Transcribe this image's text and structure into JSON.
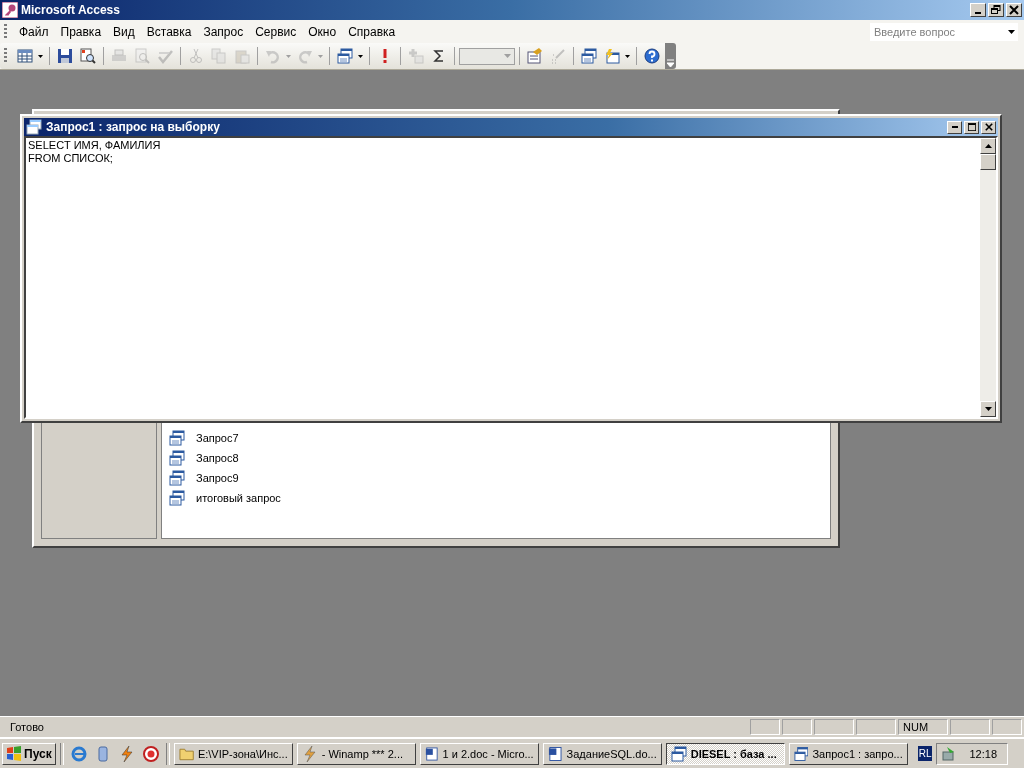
{
  "window": {
    "title": "Microsoft Access"
  },
  "menu": [
    {
      "label": "Файл"
    },
    {
      "label": "Правка"
    },
    {
      "label": "Вид"
    },
    {
      "label": "Вставка"
    },
    {
      "label": "Запрос"
    },
    {
      "label": "Сервис"
    },
    {
      "label": "Окно"
    },
    {
      "label": "Справка"
    }
  ],
  "help_box": {
    "placeholder": "Введите вопрос"
  },
  "toolbar": [
    {
      "kind": "datasheet",
      "disabled": false,
      "dropdown": true
    },
    {
      "kind": "sep"
    },
    {
      "kind": "save",
      "disabled": false
    },
    {
      "kind": "search",
      "disabled": false
    },
    {
      "kind": "sep"
    },
    {
      "kind": "print",
      "disabled": true
    },
    {
      "kind": "preview",
      "disabled": true
    },
    {
      "kind": "spell",
      "disabled": true
    },
    {
      "kind": "sep"
    },
    {
      "kind": "cut",
      "disabled": true
    },
    {
      "kind": "copy",
      "disabled": true
    },
    {
      "kind": "paste",
      "disabled": true
    },
    {
      "kind": "sep"
    },
    {
      "kind": "undo",
      "disabled": true,
      "dropdown": true
    },
    {
      "kind": "redo",
      "disabled": true,
      "dropdown": true
    },
    {
      "kind": "sep"
    },
    {
      "kind": "querytype",
      "disabled": false,
      "dropdown": true
    },
    {
      "kind": "sep"
    },
    {
      "kind": "run",
      "disabled": false
    },
    {
      "kind": "sep"
    },
    {
      "kind": "showtable",
      "disabled": true
    },
    {
      "kind": "totals",
      "disabled": false
    },
    {
      "kind": "sep"
    },
    {
      "kind": "combo",
      "disabled": true
    },
    {
      "kind": "sep"
    },
    {
      "kind": "properties",
      "disabled": false
    },
    {
      "kind": "build",
      "disabled": true
    },
    {
      "kind": "sep"
    },
    {
      "kind": "dbwindow",
      "disabled": false
    },
    {
      "kind": "newobject",
      "disabled": false,
      "dropdown": true
    },
    {
      "kind": "sep"
    },
    {
      "kind": "help",
      "disabled": false
    }
  ],
  "database_window": {
    "items": [
      {
        "label": "Запрос7"
      },
      {
        "label": "Запрос8"
      },
      {
        "label": "Запрос9"
      },
      {
        "label": "итоговый запрос"
      }
    ]
  },
  "query_window": {
    "title": "Запрос1 : запрос на выборку",
    "sql_lines": [
      "SELECT ИМЯ, ФАМИЛИЯ",
      "FROM СПИСОК;"
    ]
  },
  "status_bar": {
    "text": "Готово",
    "indicator": "NUM"
  },
  "taskbar": {
    "start": "Пуск",
    "quick_launch": [
      {
        "kind": "ie"
      },
      {
        "kind": "pc"
      },
      {
        "kind": "winamp"
      },
      {
        "kind": "media"
      }
    ],
    "tasks": [
      {
        "label": "E:\\VIP-зона\\Инс...",
        "kind": "folder",
        "selected": false
      },
      {
        "label": "- Winamp *** 2...",
        "kind": "winamp",
        "selected": false
      },
      {
        "label": "1 и 2.doc - Micro...",
        "kind": "word",
        "selected": false
      },
      {
        "label": "ЗаданиеSQL.do...",
        "kind": "word",
        "selected": false
      },
      {
        "label": "DIESEL : база ...",
        "kind": "access",
        "selected": true
      },
      {
        "label": "Запрос1 : запро...",
        "kind": "access",
        "selected": false
      }
    ],
    "language": "RL",
    "clock": "12:18"
  }
}
